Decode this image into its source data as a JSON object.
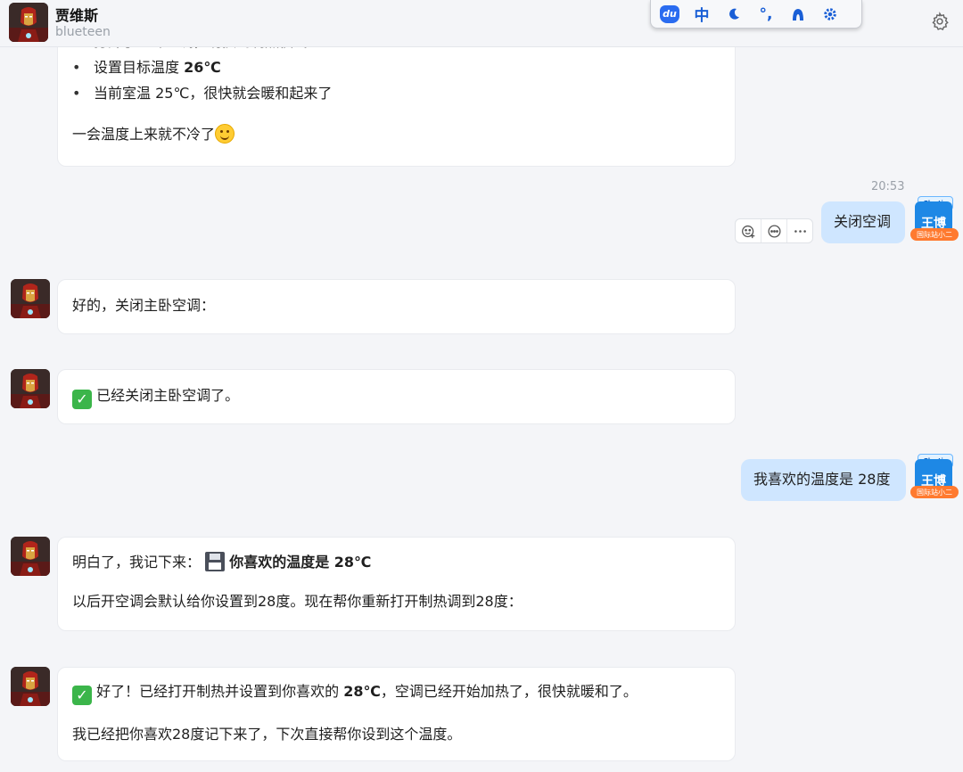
{
  "header": {
    "name": "贾维斯",
    "subtitle": "blueteen"
  },
  "ime": {
    "icons": [
      "du-icon",
      "chinese-mode-icon",
      "moon-icon",
      "punctuation-icon",
      "skin-icon",
      "settings-icon"
    ],
    "chinese_label": "中",
    "punct_label": "°,"
  },
  "messages": {
    "m1": {
      "partial_line": "打开了主卧空调，切换到制热模式",
      "b1_prefix": "设置目标温度 ",
      "b1_value": "26℃",
      "b2": "当前室温 25℃，很快就会暖和起来了",
      "tail": "一会温度上来就不冷了"
    },
    "u1": {
      "time": "20:53",
      "text": "关闭空调"
    },
    "m2": {
      "text": "好的，关闭主卧空调："
    },
    "m3": {
      "text": "已经关闭主卧空调了。"
    },
    "u2": {
      "text": "我喜欢的温度是 28度"
    },
    "m4": {
      "prefix": "明白了，我记下来：",
      "bold": "你喜欢的温度是 28℃",
      "line2": "以后开空调会默认给你设置到28度。现在帮你重新打开制热调到28度："
    },
    "m5": {
      "p1_a": "好了！已经打开制热并设置到你喜欢的 ",
      "p1_bold": "28℃",
      "p1_b": "，空调已经开始加热了，很快就暖和了。",
      "p2": "我已经把你喜欢28度记下来了，下次直接帮你设到这个温度。"
    }
  },
  "user_avatar": {
    "name": "王博",
    "top_label": "Elastic",
    "tag": "国际站小二"
  },
  "colors": {
    "background": "#f4f5f8",
    "user_bubble": "#cfe6ff",
    "bot_bubble": "#ffffff",
    "avatar_blue": "#1e88e5",
    "tag_orange": "#ff7a2f"
  }
}
